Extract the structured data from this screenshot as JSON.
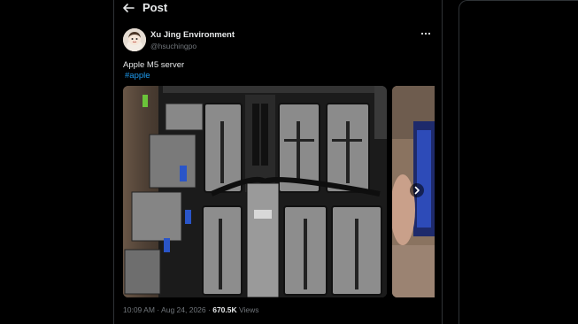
{
  "header": {
    "title": "Post",
    "back_icon": "arrow-left-icon"
  },
  "post": {
    "author_name": "Xu Jing Environment",
    "author_handle": "@hsuchingpo",
    "text": "Apple M5 server",
    "hashtag": "#apple",
    "more_icon": "more-horizontal-icon",
    "media_next_icon": "chevron-right-icon",
    "time": "10:09 AM",
    "separator": "·",
    "date": "Aug 24, 2026",
    "views_count": "670.5K",
    "views_label": "Views"
  },
  "colors": {
    "background": "#000000",
    "text": "#e7e9ea",
    "muted": "#71767b",
    "link": "#1d9bf0",
    "border": "#2f3336"
  }
}
